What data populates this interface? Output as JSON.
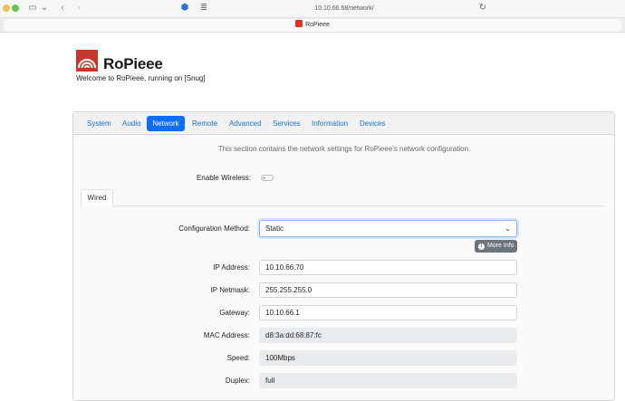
{
  "browser": {
    "url": "10.10.66.68/network/",
    "tab_title": "RoPieee"
  },
  "header": {
    "brand": "RoPieee",
    "welcome": "Welcome to RoPieee, running on [Snug]"
  },
  "nav": {
    "items": [
      {
        "label": "System"
      },
      {
        "label": "Audio"
      },
      {
        "label": "Network"
      },
      {
        "label": "Remote"
      },
      {
        "label": "Advanced"
      },
      {
        "label": "Services"
      },
      {
        "label": "Information"
      },
      {
        "label": "Devices"
      }
    ],
    "active": "Network"
  },
  "network": {
    "intro": "This section contains the network settings for RoPieee's network configuration.",
    "enable_wireless_label": "Enable Wireless:",
    "enable_wireless": false,
    "subtab": "Wired",
    "config_method_label": "Configuration Method:",
    "config_method": "Static",
    "more_info": "More Info",
    "fields": {
      "ip_label": "IP Address:",
      "ip": "10.10.66.70",
      "netmask_label": "IP Netmask:",
      "netmask": "255.255.255.0",
      "gateway_label": "Gateway:",
      "gateway": "10.10.66.1",
      "mac_label": "MAC Address:",
      "mac": "d8:3a:dd:68:87:fc",
      "speed_label": "Speed:",
      "speed": "100Mbps",
      "duplex_label": "Duplex:",
      "duplex": "full"
    }
  },
  "colors": {
    "accent": "#0d6efd",
    "brand_red": "#c8372d",
    "button_gray": "#6c757d"
  }
}
